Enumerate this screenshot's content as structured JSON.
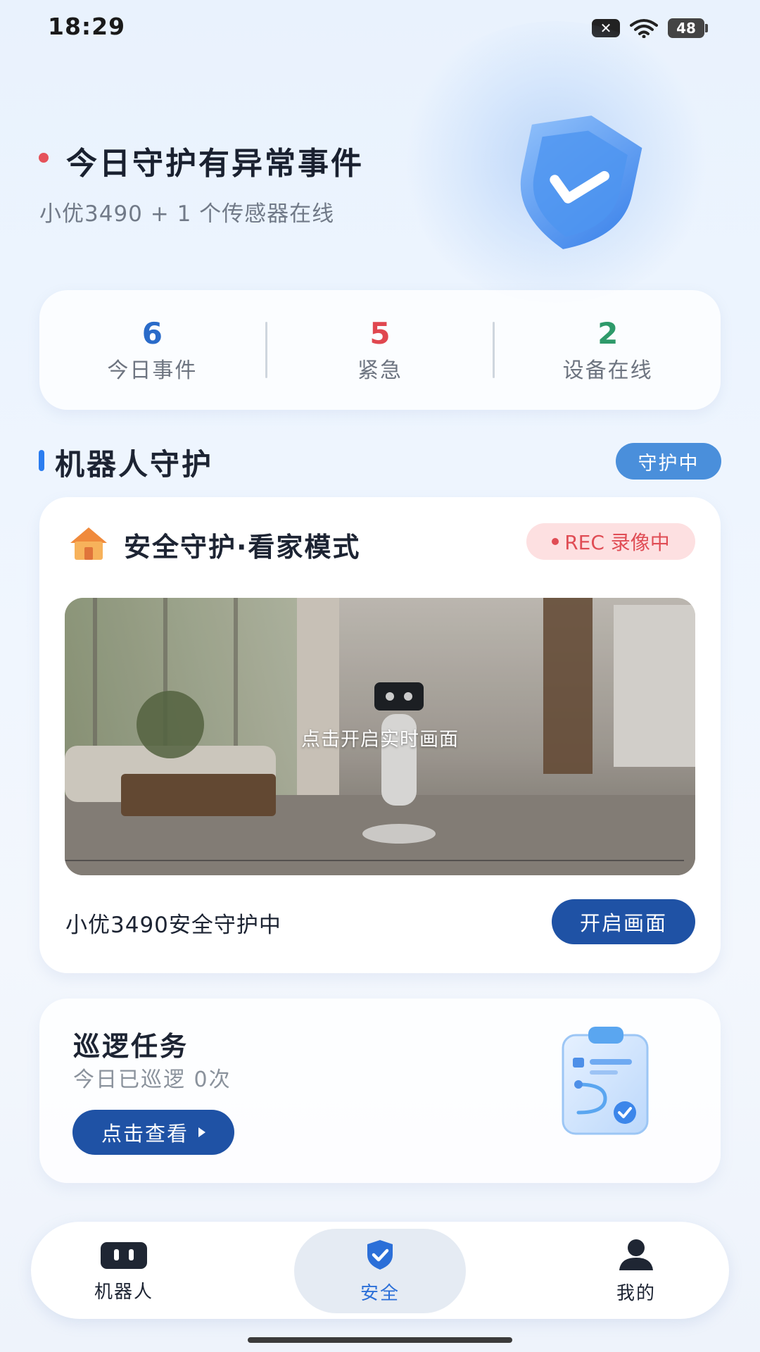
{
  "status_bar": {
    "time": "18:29",
    "battery": "48"
  },
  "hero": {
    "title": "今日守护有异常事件",
    "subtitle": "小优3490 + 1 个传感器在线"
  },
  "stats": [
    {
      "value": "6",
      "label": "今日事件",
      "color": "#2a6bc9"
    },
    {
      "value": "5",
      "label": "紧急",
      "color": "#e0474f"
    },
    {
      "value": "2",
      "label": "设备在线",
      "color": "#2e9a6a"
    }
  ],
  "section": {
    "title": "机器人守护",
    "status_pill": "守护中"
  },
  "guard_card": {
    "mode_title": "安全守护·看家模式",
    "rec_label": "REC 录像中",
    "video_caption": "点击开启实时画面",
    "device_status": "小优3490安全守护中",
    "open_button": "开启画面"
  },
  "patrol": {
    "title": "巡逻任务",
    "subtitle": "今日已巡逻 0次",
    "view_button": "点击查看"
  },
  "nav": {
    "items": [
      {
        "label": "机器人",
        "icon": "robot-icon"
      },
      {
        "label": "安全",
        "icon": "shield-icon",
        "active": true
      },
      {
        "label": "我的",
        "icon": "user-icon"
      }
    ]
  },
  "colors": {
    "accent": "#1f52a5",
    "alert": "#e5525a",
    "light_blue": "#4a8fdb"
  }
}
